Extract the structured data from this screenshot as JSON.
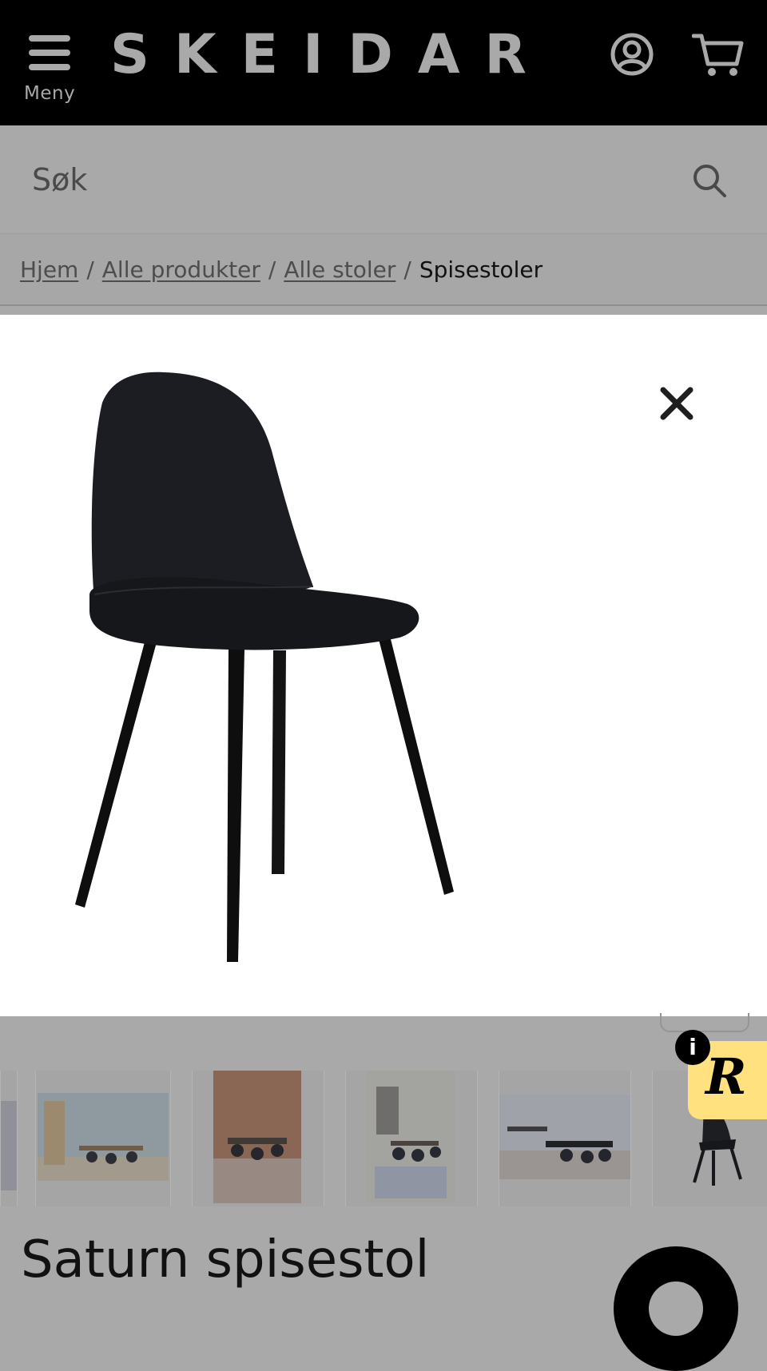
{
  "header": {
    "menu_label": "Meny",
    "logo": "SKEIDAR",
    "account_icon": "user-circle-icon",
    "cart_icon": "shopping-cart-icon",
    "background": "#000000"
  },
  "search": {
    "placeholder": "Søk",
    "icon": "search-icon"
  },
  "breadcrumb": {
    "items": [
      "Hjem",
      "Alle produkter",
      "Alle stoler"
    ],
    "current": "Spisestoler",
    "separator": "/"
  },
  "gallery": {
    "close_icon": "close-icon",
    "main_image": "black dining chair with metal legs",
    "thumbnails": [
      "dining room scene",
      "dining room scene",
      "dining room with brown wall",
      "dining room with rug",
      "dining room with black table",
      "black dining chair"
    ]
  },
  "product": {
    "title": "Saturn spisestol"
  },
  "badge": {
    "info_label": "i",
    "letter": "R",
    "color": "#ffe180"
  },
  "colors": {
    "overlay": "#a9a9a9",
    "text_dark": "#111111"
  }
}
